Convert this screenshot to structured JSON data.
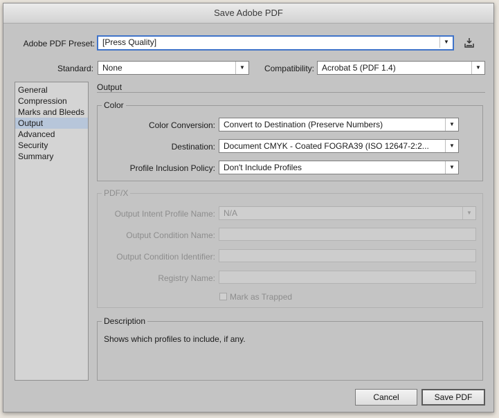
{
  "window": {
    "title": "Save Adobe PDF"
  },
  "preset": {
    "label": "Adobe PDF Preset:",
    "value": "[Press Quality]",
    "save_icon": "save-preset-icon"
  },
  "standard": {
    "label": "Standard:",
    "value": "None"
  },
  "compatibility": {
    "label": "Compatibility:",
    "value": "Acrobat 5 (PDF 1.4)"
  },
  "sidebar": {
    "items": [
      {
        "label": "General"
      },
      {
        "label": "Compression"
      },
      {
        "label": "Marks and Bleeds"
      },
      {
        "label": "Output"
      },
      {
        "label": "Advanced"
      },
      {
        "label": "Security"
      },
      {
        "label": "Summary"
      }
    ],
    "selected": "Output"
  },
  "panel": {
    "title": "Output"
  },
  "color_group": {
    "title": "Color",
    "conversion_label": "Color Conversion:",
    "conversion_value": "Convert to Destination (Preserve Numbers)",
    "destination_label": "Destination:",
    "destination_value": "Document CMYK - Coated FOGRA39 (ISO 12647-2:2...",
    "profile_label": "Profile Inclusion Policy:",
    "profile_value": "Don't Include Profiles"
  },
  "pdfx_group": {
    "title": "PDF/X",
    "intent_label": "Output Intent Profile Name:",
    "intent_value": "N/A",
    "condition_name_label": "Output Condition Name:",
    "condition_id_label": "Output Condition Identifier:",
    "registry_label": "Registry Name:",
    "trapped_label": "Mark as Trapped"
  },
  "description_group": {
    "title": "Description",
    "text": "Shows which profiles to include, if any."
  },
  "buttons": {
    "cancel": "Cancel",
    "save": "Save PDF"
  }
}
